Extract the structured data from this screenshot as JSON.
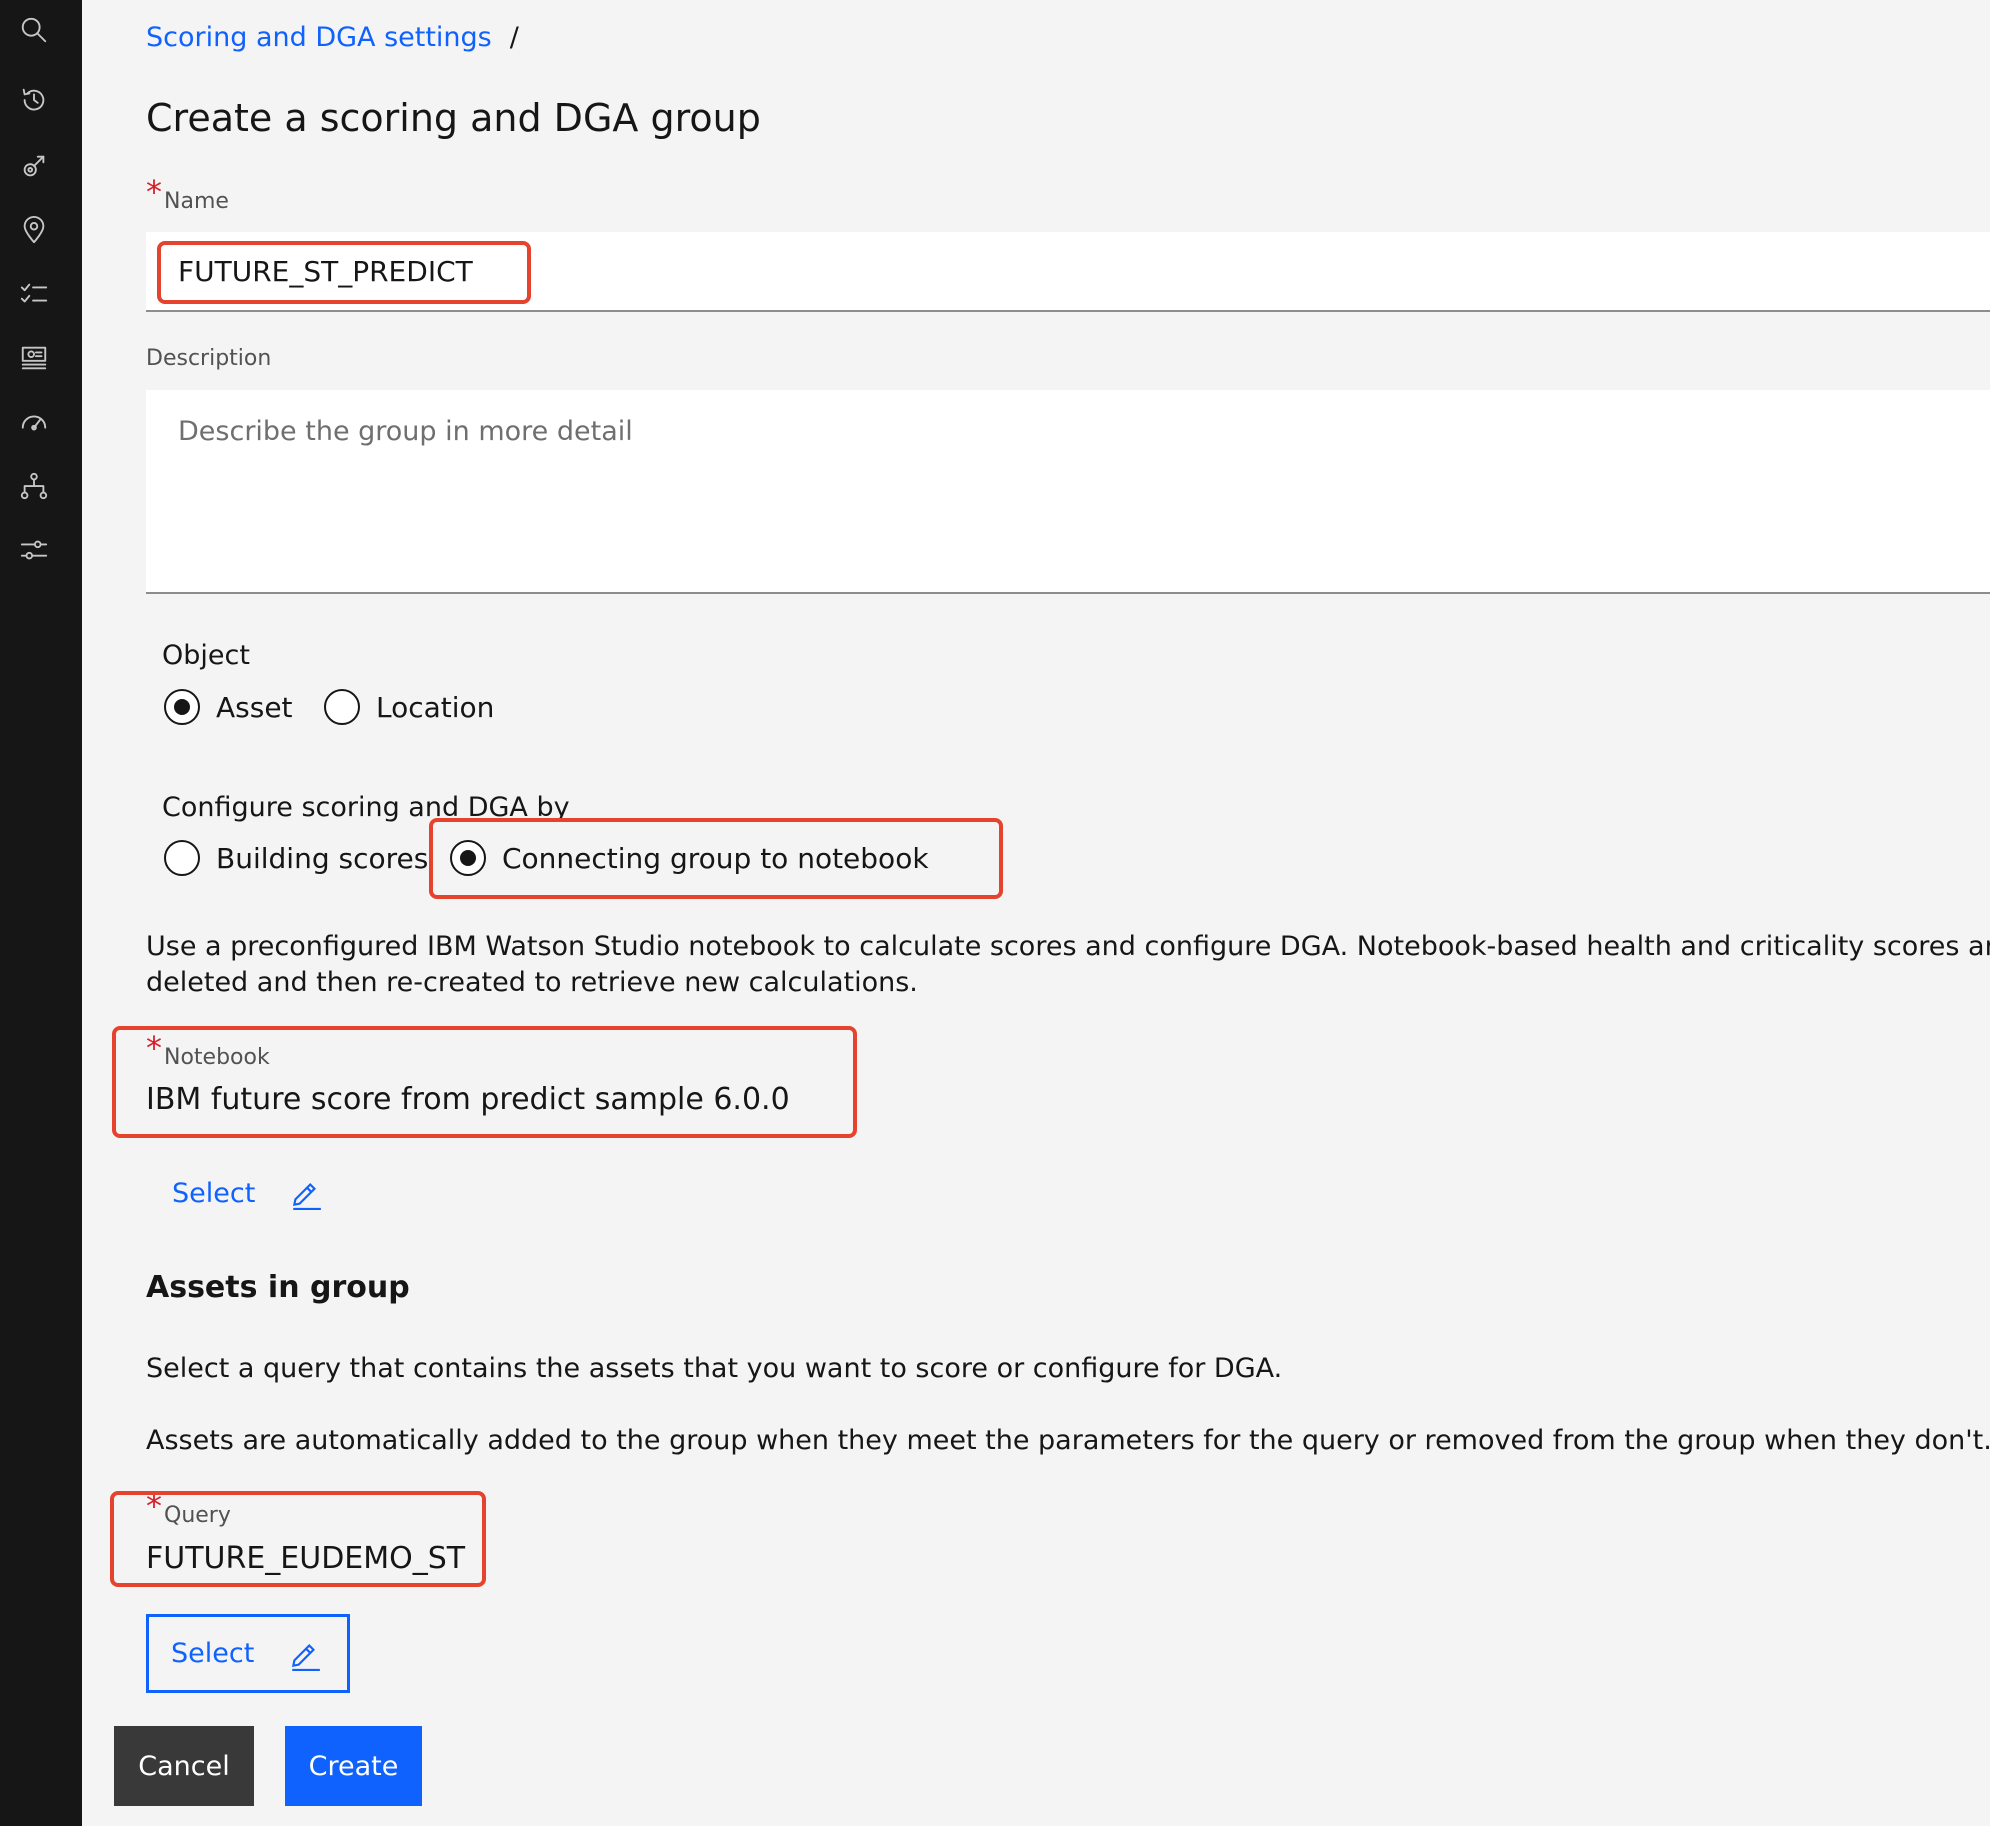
{
  "breadcrumb": {
    "parent": "Scoring and DGA settings",
    "separator": "/"
  },
  "page_title": "Create a scoring and DGA group",
  "name_field": {
    "required_mark": "*",
    "label": "Name",
    "value": "FUTURE_ST_PREDICT"
  },
  "description_field": {
    "label": "Description",
    "placeholder": "Describe the group in more detail"
  },
  "object_group": {
    "label": "Object",
    "options": [
      {
        "label": "Asset",
        "selected": true
      },
      {
        "label": "Location",
        "selected": false
      }
    ]
  },
  "configure_group": {
    "label": "Configure scoring and DGA by",
    "options": [
      {
        "label": "Building scores",
        "selected": false
      },
      {
        "label": "Connecting group to notebook",
        "selected": true
      }
    ]
  },
  "notebook_help": [
    "Use a preconfigured IBM Watson Studio notebook to calculate scores and configure DGA. Notebook-based health and criticality scores are edita",
    "deleted and then re-created to retrieve new calculations."
  ],
  "notebook_field": {
    "required_mark": "*",
    "label": "Notebook",
    "value": "IBM future score from predict sample 6.0.0",
    "select_label": "Select"
  },
  "assets_section": {
    "title": "Assets in group",
    "text1": "Select a query that contains the assets that you want to score or configure for DGA.",
    "text2": "Assets are automatically added to the group when they meet the parameters for the query or removed from the group when they don't."
  },
  "query_field": {
    "required_mark": "*",
    "label": "Query",
    "value": "FUTURE_EUDEMO_ST",
    "select_label": "Select"
  },
  "actions": {
    "cancel": "Cancel",
    "create": "Create"
  },
  "sidebar_icons": [
    "search-icon",
    "history-icon",
    "satellite-icon",
    "location-icon",
    "checklist-icon",
    "dashboard-icon",
    "gauge-icon",
    "hierarchy-icon",
    "settings-sliders-icon"
  ],
  "colors": {
    "accent": "#0f62fe",
    "required": "#da1e28",
    "annotation": "#e5432e",
    "sidebar": "#161616",
    "background": "#f4f4f4"
  }
}
